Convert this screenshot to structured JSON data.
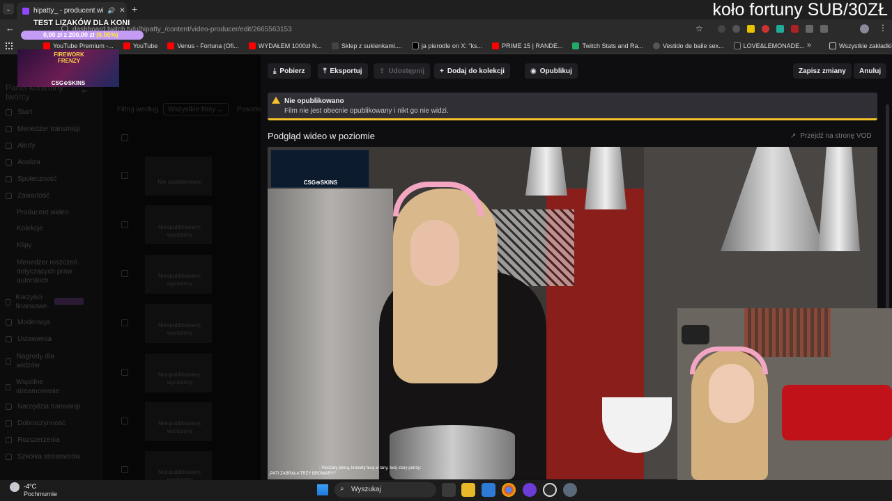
{
  "browser": {
    "tab_title": "hipatty_ - producent wideo",
    "url": "dashboard.twitch.tv/u/hipatty_/content/video-producer/edit/2665563153",
    "bookmarks": [
      "YouTube Premium -...",
      "YouTube",
      "Venus - Fortuna (Ofi...",
      "WYDAŁEM 1000zł N...",
      "Sklep z sukienkami....",
      "ja pierodle on X: \"ks...",
      "PRIME 15 | RANDE...",
      "Twitch Stats and Ra...",
      "Vestido de baile sex...",
      "LOVE&LEMONADE..."
    ],
    "all_bookmarks": "Wszystkie zakładki",
    "bookmark_colors": [
      "#ff0000",
      "#ff0000",
      "#ff0000",
      "#ff0000",
      "#444444",
      "#000000",
      "#ff0000",
      "#2a6",
      "#555",
      "#222"
    ]
  },
  "stream_overlay": {
    "top_right": "koło fortuny SUB/30ZŁ",
    "goal_title": "TEST LIZAKÓW DLA KONI",
    "goal_progress": "0,00 zł z 200,00 zł",
    "goal_percent": "(0.00%)",
    "goal_fraction": 0,
    "promo_title": "FIREWORK FRENZY",
    "promo_brand": "CSG⊕SKINS",
    "video_brand": "CSG⊕SKINS",
    "chat_line1": ": Pieczary płoną, krokiety lecą w tany, twój stary patrzy:",
    "chat_line2": "„PATI ZABRAŁA TRZY BROWARY!\""
  },
  "sidebar": {
    "title": "Panel kontrolny twórcy",
    "items": [
      "Start",
      "Menedżer transmisji",
      "Alerty",
      "Analiza",
      "Społeczność",
      "Zawartość",
      "Producent wideo",
      "Kolekcje",
      "Klipy",
      "Menedżer roszczeń dotyczących praw autorskich",
      "Korzyści finansowe",
      "Moderacja",
      "Ustawienia",
      "Nagrody dla widzów",
      "Wspólne streamowanie",
      "Narzędzia transmisji",
      "Dobroczynność",
      "Rozszerzenia",
      "Szkółka streamerów"
    ]
  },
  "filter": {
    "label": "Filtruj według",
    "value": "Wszystkie filmy",
    "sort_partial": "Posorto"
  },
  "video_list": [
    {
      "label": "Nie opublikowano"
    },
    {
      "label": "Nieopublikowany, wyciszony"
    },
    {
      "label": "Nieopublikowany, wyciszony"
    },
    {
      "label": "Nieopublikowany, wyciszony"
    },
    {
      "label": "Nieopublikowany, wyciszony"
    },
    {
      "label": "Nieopublikowany, wyciszony"
    },
    {
      "label": "Nieopublikowany, wyciszony"
    }
  ],
  "toolbar": {
    "download": "Pobierz",
    "export": "Eksportuj",
    "share": "Udostępnij",
    "add_collection": "Dodaj do kolekcji",
    "publish": "Opublikuj",
    "save": "Zapisz zmiany",
    "cancel": "Anuluj"
  },
  "alert": {
    "title": "Nie opublikowano",
    "message": "Film nie jest obecnie opublikowany i nikt go nie widzi."
  },
  "preview": {
    "title": "Podgląd wideo w poziomie",
    "vod_link": "Przejdź na stronę VOD"
  },
  "taskbar": {
    "temperature": "-4°C",
    "weather": "Pochmurnie",
    "search": "Wyszukaj"
  }
}
